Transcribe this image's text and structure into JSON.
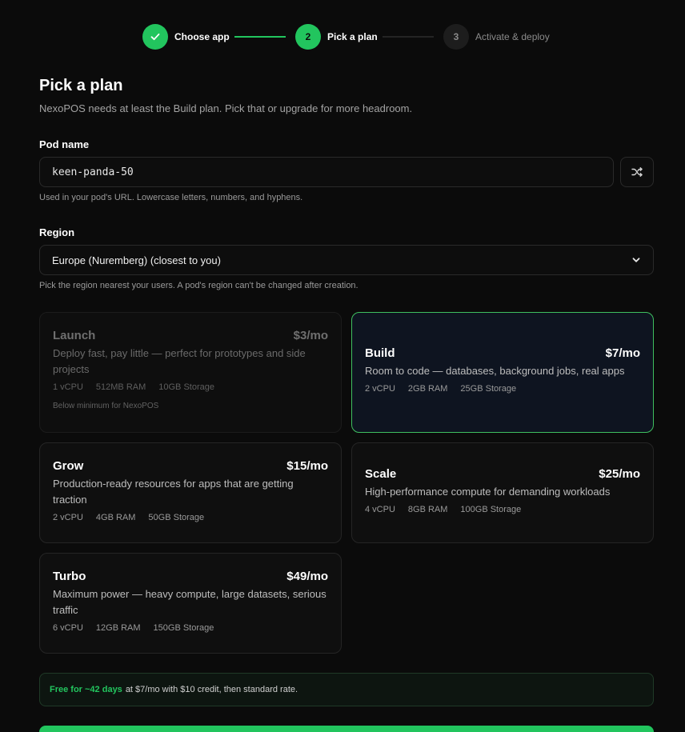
{
  "stepper": {
    "steps": [
      {
        "label": "Choose app",
        "number": "",
        "state": "done"
      },
      {
        "label": "Pick a plan",
        "number": "2",
        "state": "active"
      },
      {
        "label": "Activate & deploy",
        "number": "3",
        "state": "pending"
      }
    ]
  },
  "header": {
    "title": "Pick a plan",
    "subtitle": "NexoPOS needs at least the Build plan. Pick that or upgrade for more headroom."
  },
  "pod": {
    "label": "Pod name",
    "value": "keen-panda-50",
    "help": "Used in your pod's URL. Lowercase letters, numbers, and hyphens."
  },
  "region": {
    "label": "Region",
    "selected": "Europe (Nuremberg) (closest to you)",
    "help": "Pick the region nearest your users. A pod's region can't be changed after creation."
  },
  "plans": [
    {
      "name": "Launch",
      "price": "$3/mo",
      "desc": "Deploy fast, pay little — perfect for prototypes and side projects",
      "cpu": "1 vCPU",
      "ram": "512MB RAM",
      "storage": "10GB Storage",
      "note": "Below minimum for NexoPOS",
      "state": "disabled"
    },
    {
      "name": "Build",
      "price": "$7/mo",
      "desc": "Room to code — databases, background jobs, real apps",
      "cpu": "2 vCPU",
      "ram": "2GB RAM",
      "storage": "25GB Storage",
      "state": "selected"
    },
    {
      "name": "Grow",
      "price": "$15/mo",
      "desc": "Production-ready resources for apps that are getting traction",
      "cpu": "2 vCPU",
      "ram": "4GB RAM",
      "storage": "50GB Storage",
      "state": "default"
    },
    {
      "name": "Scale",
      "price": "$25/mo",
      "desc": "High-performance compute for demanding workloads",
      "cpu": "4 vCPU",
      "ram": "8GB RAM",
      "storage": "100GB Storage",
      "state": "default"
    },
    {
      "name": "Turbo",
      "price": "$49/mo",
      "desc": "Maximum power — heavy compute, large datasets, serious traffic",
      "cpu": "6 vCPU",
      "ram": "12GB RAM",
      "storage": "150GB Storage",
      "state": "default"
    }
  ],
  "credit": {
    "highlight": "Free for ~42 days",
    "text": "at $7/mo with $10 credit, then standard rate."
  },
  "colors": {
    "accent": "#22c55e",
    "background": "#0b0b0b",
    "selected_border": "#3fbf5f"
  }
}
